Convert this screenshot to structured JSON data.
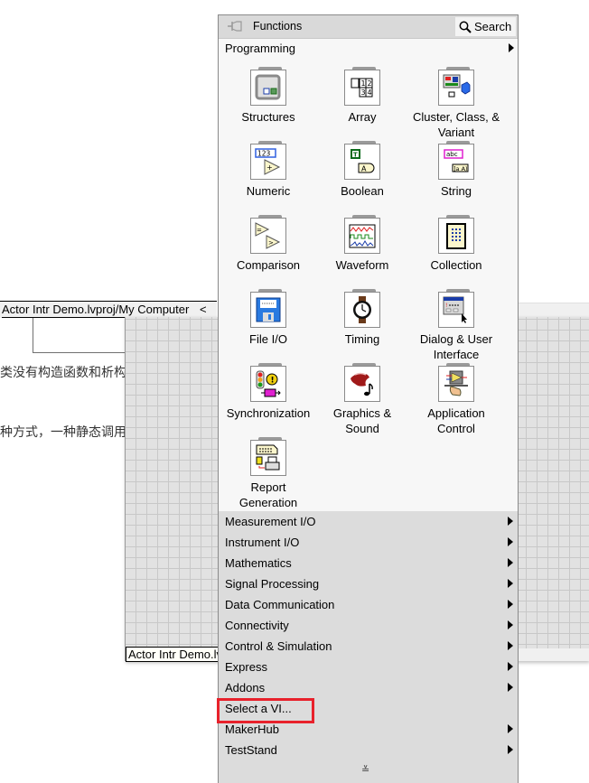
{
  "background": {
    "text_line_1": "类没有构造函数和析构",
    "text_line_2": "种方式，一种静态调用"
  },
  "project_window": {
    "title": "Actor Intr Demo.lvproj/My Computer",
    "chevron": "<"
  },
  "diagram_window": {
    "label": "Actor Intr Demo.lvproj"
  },
  "palette": {
    "title": "Functions",
    "search_label": "Search",
    "section": "Programming",
    "icons": [
      {
        "label": "Structures",
        "icon": "structures-icon"
      },
      {
        "label": "Array",
        "icon": "array-icon"
      },
      {
        "label": "Cluster, Class, & Variant",
        "icon": "cluster-icon"
      },
      {
        "label": "Numeric",
        "icon": "numeric-icon"
      },
      {
        "label": "Boolean",
        "icon": "boolean-icon"
      },
      {
        "label": "String",
        "icon": "string-icon"
      },
      {
        "label": "Comparison",
        "icon": "comparison-icon"
      },
      {
        "label": "Waveform",
        "icon": "waveform-icon"
      },
      {
        "label": "Collection",
        "icon": "collection-icon"
      },
      {
        "label": "File I/O",
        "icon": "file-io-icon"
      },
      {
        "label": "Timing",
        "icon": "timing-icon"
      },
      {
        "label": "Dialog & User Interface",
        "icon": "dialog-icon"
      },
      {
        "label": "Synchronization",
        "icon": "synchronization-icon"
      },
      {
        "label": "Graphics & Sound",
        "icon": "graphics-sound-icon"
      },
      {
        "label": "Application Control",
        "icon": "application-control-icon"
      },
      {
        "label": "Report Generation",
        "icon": "report-generation-icon"
      }
    ],
    "subpalettes": [
      {
        "label": "Measurement I/O",
        "has_arrow": true
      },
      {
        "label": "Instrument I/O",
        "has_arrow": true
      },
      {
        "label": "Mathematics",
        "has_arrow": true
      },
      {
        "label": "Signal Processing",
        "has_arrow": true
      },
      {
        "label": "Data Communication",
        "has_arrow": true
      },
      {
        "label": "Connectivity",
        "has_arrow": true
      },
      {
        "label": "Control & Simulation",
        "has_arrow": true
      },
      {
        "label": "Express",
        "has_arrow": true
      },
      {
        "label": "Addons",
        "has_arrow": true
      },
      {
        "label": "Select a VI...",
        "has_arrow": false,
        "highlighted": true
      },
      {
        "label": "MakerHub",
        "has_arrow": true
      },
      {
        "label": "TestStand",
        "has_arrow": true
      }
    ],
    "more_glyph": "≚",
    "highlight_color": "#e8212b"
  }
}
